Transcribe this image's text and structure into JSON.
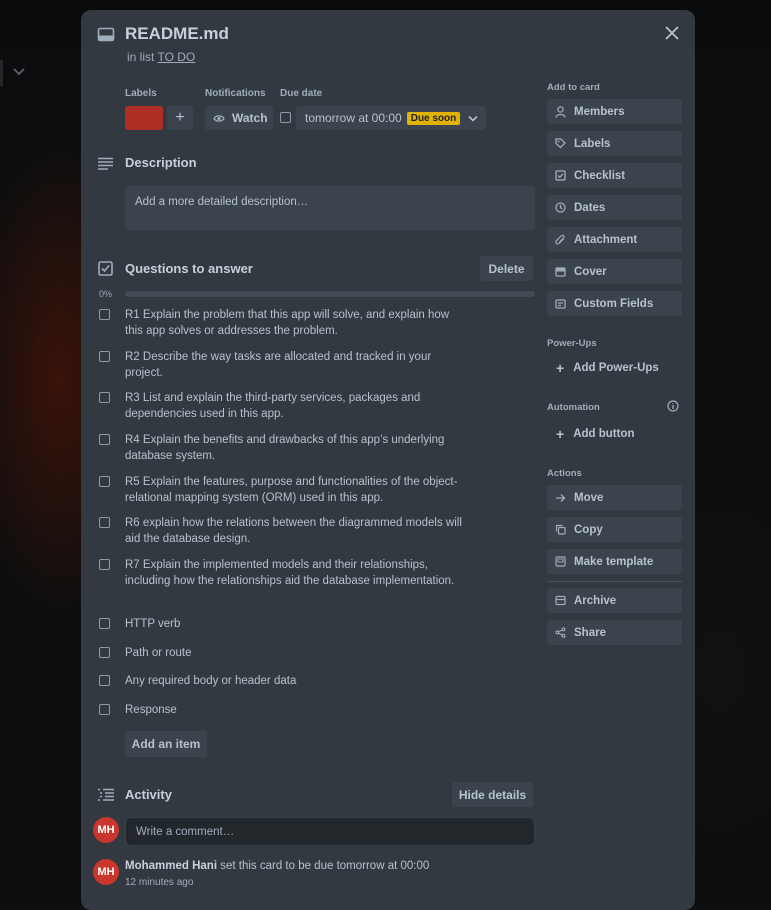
{
  "card": {
    "title": "README.md",
    "in_list_prefix": "in list",
    "list_name": "TO DO"
  },
  "fields": {
    "labels_heading": "Labels",
    "label_color": "#ae2e24",
    "notifications_heading": "Notifications",
    "watch_label": "Watch",
    "due_heading": "Due date",
    "due_value": "tomorrow at 00:00",
    "due_badge": "Due soon"
  },
  "description": {
    "title": "Description",
    "placeholder": "Add a more detailed description…"
  },
  "checklist": {
    "title": "Questions to answer",
    "delete_label": "Delete",
    "progress_text": "0%",
    "progress": 0,
    "items": [
      "R1 Explain the problem that this app will solve, and explain how this app solves or addresses the problem.",
      "R2 Describe the way tasks are allocated and tracked in your project.",
      "R3 List and explain the third-party services, packages and dependencies used in this app.",
      "R4 Explain the benefits and drawbacks of this app’s underlying database system.",
      "R5 Explain the features, purpose and functionalities of the object-relational mapping system (ORM) used in this app.",
      "R6 explain how the relations between the diagrammed models will aid the database design.",
      "R7 Explain the implemented models and their relationships, including how the relationships aid the database implementation.",
      "HTTP verb",
      "Path or route",
      "Any required body or header data",
      "Response"
    ],
    "add_item_label": "Add an item"
  },
  "activity": {
    "title": "Activity",
    "hide_details_label": "Hide details",
    "avatar_initials": "MH",
    "comment_placeholder": "Write a comment…",
    "entry_user": "Mohammed Hani",
    "entry_text": "set this card to be due tomorrow at 00:00",
    "entry_time": "12 minutes ago"
  },
  "sidebar": {
    "add_to_card_heading": "Add to card",
    "add_to_card": [
      "Members",
      "Labels",
      "Checklist",
      "Dates",
      "Attachment",
      "Cover",
      "Custom Fields"
    ],
    "powerups_heading": "Power-Ups",
    "add_powerups": "Add Power-Ups",
    "automation_heading": "Automation",
    "add_button": "Add button",
    "actions_heading": "Actions",
    "actions": [
      "Move",
      "Copy",
      "Make template",
      "Archive",
      "Share"
    ]
  },
  "colors": {
    "modal_bg": "#323940",
    "button_bg": "#3b444c",
    "due_badge": "#e2b203",
    "avatar": "#c9372c"
  }
}
